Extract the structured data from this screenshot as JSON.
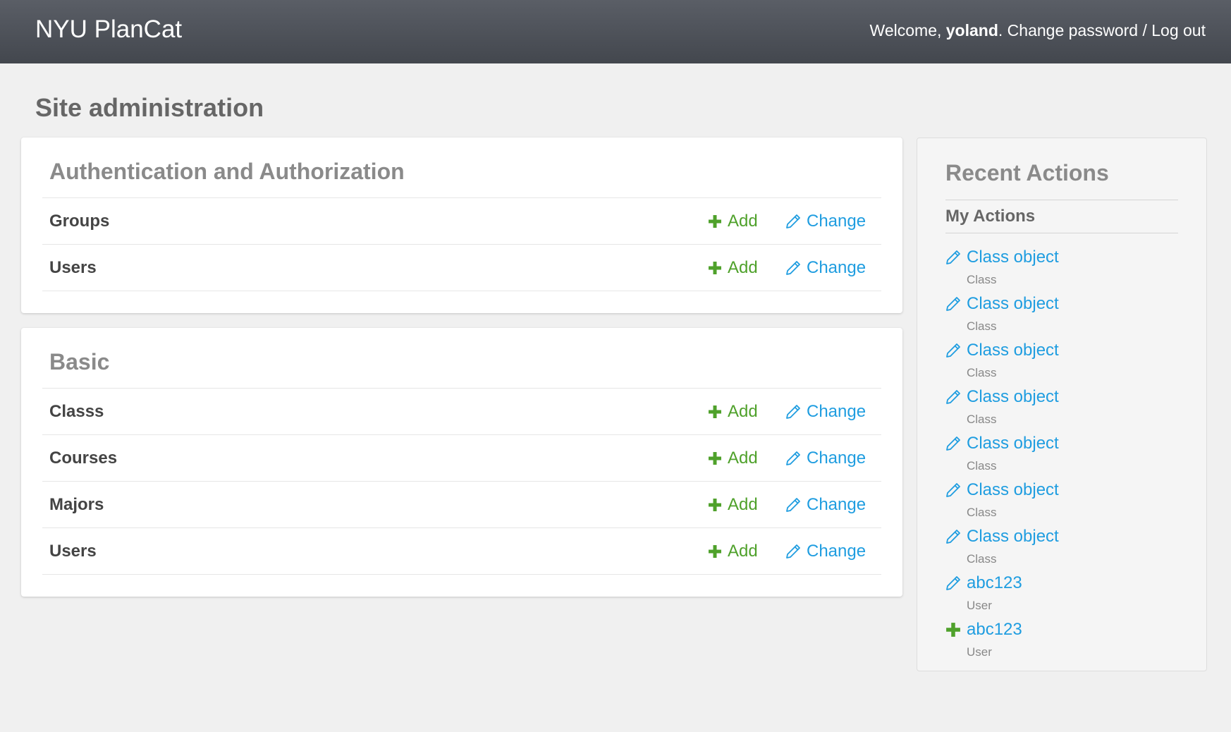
{
  "header": {
    "brand": "NYU PlanCat",
    "welcome": "Welcome, ",
    "username": "yoland",
    "after_username": ". ",
    "change_password": "Change password",
    "separator": " / ",
    "logout": "Log out"
  },
  "page_title": "Site administration",
  "modules": [
    {
      "caption": "Authentication and Authorization",
      "models": [
        {
          "name": "Groups",
          "add": "Add",
          "change": "Change"
        },
        {
          "name": "Users",
          "add": "Add",
          "change": "Change"
        }
      ]
    },
    {
      "caption": "Basic",
      "models": [
        {
          "name": "Classs",
          "add": "Add",
          "change": "Change"
        },
        {
          "name": "Courses",
          "add": "Add",
          "change": "Change"
        },
        {
          "name": "Majors",
          "add": "Add",
          "change": "Change"
        },
        {
          "name": "Users",
          "add": "Add",
          "change": "Change"
        }
      ]
    }
  ],
  "recent_actions": {
    "title": "Recent Actions",
    "subtitle": "My Actions",
    "items": [
      {
        "icon": "pencil-icon",
        "label": "Class object",
        "type": "Class"
      },
      {
        "icon": "pencil-icon",
        "label": "Class object",
        "type": "Class"
      },
      {
        "icon": "pencil-icon",
        "label": "Class object",
        "type": "Class"
      },
      {
        "icon": "pencil-icon",
        "label": "Class object",
        "type": "Class"
      },
      {
        "icon": "pencil-icon",
        "label": "Class object",
        "type": "Class"
      },
      {
        "icon": "pencil-icon",
        "label": "Class object",
        "type": "Class"
      },
      {
        "icon": "pencil-icon",
        "label": "Class object",
        "type": "Class"
      },
      {
        "icon": "pencil-icon",
        "label": "abc123",
        "type": "User"
      },
      {
        "icon": "plus-icon",
        "label": "abc123",
        "type": "User"
      }
    ]
  },
  "colors": {
    "add": "#4fa12b",
    "change": "#1f9de0",
    "header_bg": "#4a4e55"
  }
}
